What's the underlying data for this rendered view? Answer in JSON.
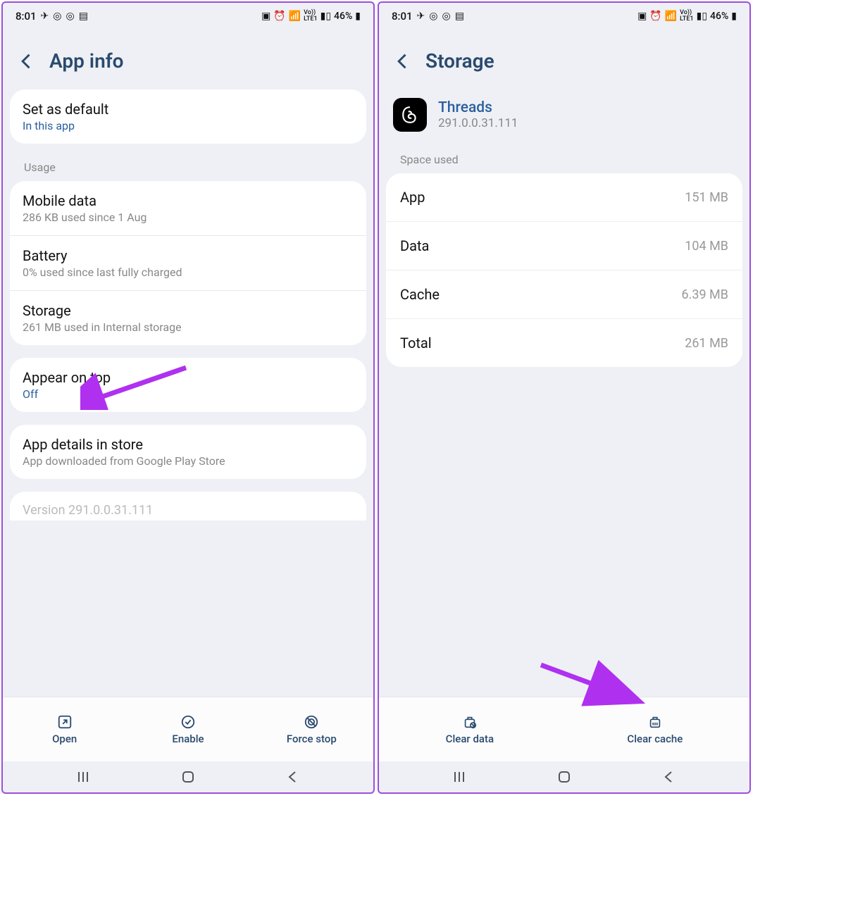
{
  "status": {
    "time": "8:01",
    "battery": "46%"
  },
  "left": {
    "title": "App info",
    "set_default": {
      "title": "Set as default",
      "sub": "In this app"
    },
    "usage_label": "Usage",
    "usage": [
      {
        "title": "Mobile data",
        "sub": "286 KB used since 1 Aug"
      },
      {
        "title": "Battery",
        "sub": "0% used since last fully charged"
      },
      {
        "title": "Storage",
        "sub": "261 MB used in Internal storage"
      }
    ],
    "appear": {
      "title": "Appear on top",
      "sub": "Off"
    },
    "store": {
      "title": "App details in store",
      "sub": "App downloaded from Google Play Store"
    },
    "version_partial": "Version 291.0.0.31.111",
    "bottom": {
      "open": "Open",
      "enable": "Enable",
      "forcestop": "Force stop"
    }
  },
  "right": {
    "title": "Storage",
    "app": {
      "name": "Threads",
      "version": "291.0.0.31.111"
    },
    "space_label": "Space used",
    "rows": [
      {
        "label": "App",
        "value": "151 MB"
      },
      {
        "label": "Data",
        "value": "104 MB"
      },
      {
        "label": "Cache",
        "value": "6.39 MB"
      },
      {
        "label": "Total",
        "value": "261 MB"
      }
    ],
    "bottom": {
      "cleardata": "Clear data",
      "clearcache": "Clear cache"
    }
  }
}
